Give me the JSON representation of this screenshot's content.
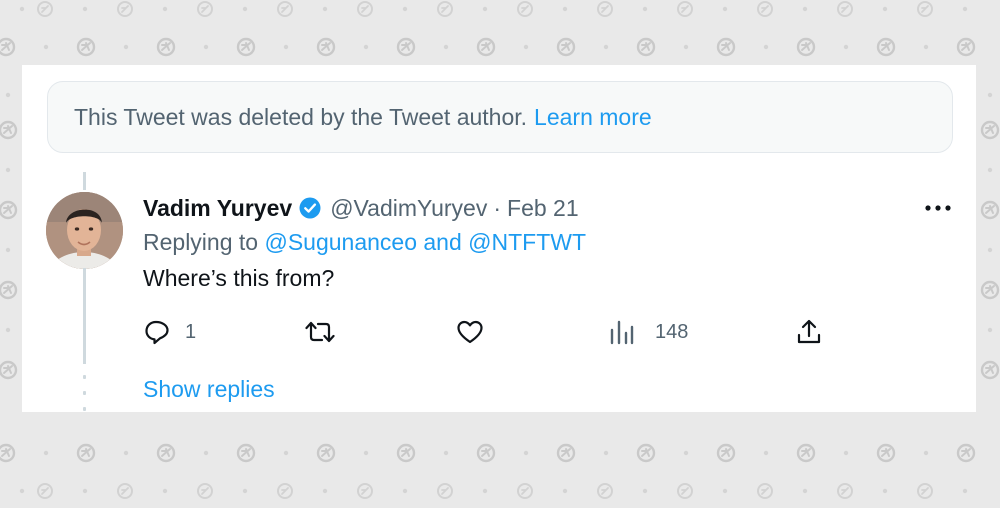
{
  "notice": {
    "text": "This Tweet was deleted by the Tweet author.",
    "link_label": "Learn more"
  },
  "reply": {
    "author_name": "Vadim Yuryev",
    "handle": "@VadimYuryev",
    "separator": "·",
    "date": "Feb 21",
    "replying_prefix": "Replying to",
    "replying_to_1": "@Sugunanceo",
    "replying_joiner": "and",
    "replying_to_2": "@NTFTWT",
    "text": "Where’s this from?",
    "actions": {
      "reply_count": "1",
      "view_count": "148"
    }
  },
  "show_replies_label": "Show replies",
  "colors": {
    "accent": "#1d9bf0",
    "secondary_text": "#536471",
    "primary_text": "#0f1419",
    "background_pattern": "#e9e9e9"
  },
  "icons": [
    "verified-badge-icon",
    "more-icon",
    "reply-icon",
    "retweet-icon",
    "like-icon",
    "views-icon",
    "share-icon",
    "watermark-icon"
  ]
}
